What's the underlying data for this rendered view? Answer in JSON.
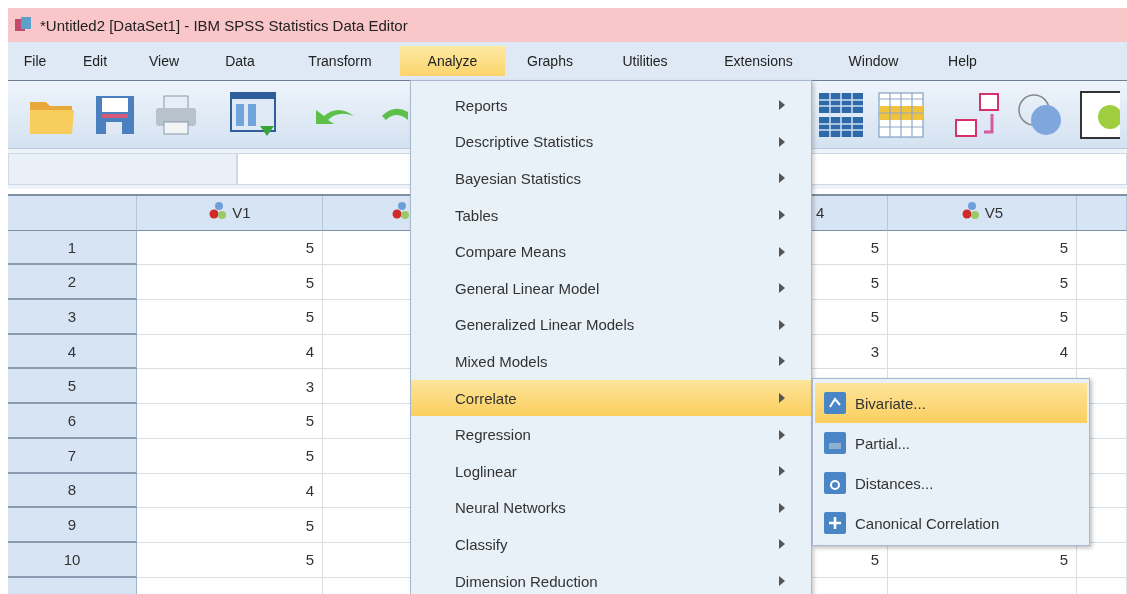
{
  "window": {
    "title": "*Untitled2 [DataSet1] - IBM SPSS Statistics Data Editor"
  },
  "menu_bar": [
    {
      "label": "File",
      "selected": false
    },
    {
      "label": "Edit",
      "selected": false
    },
    {
      "label": "View",
      "selected": false
    },
    {
      "label": "Data",
      "selected": false
    },
    {
      "label": "Transform",
      "selected": false
    },
    {
      "label": "Analyze",
      "selected": true
    },
    {
      "label": "Graphs",
      "selected": false
    },
    {
      "label": "Utilities",
      "selected": false
    },
    {
      "label": "Extensions",
      "selected": false
    },
    {
      "label": "Window",
      "selected": false
    },
    {
      "label": "Help",
      "selected": false
    }
  ],
  "analyze_menu": [
    {
      "label": "Reports",
      "selected": false
    },
    {
      "label": "Descriptive Statistics",
      "selected": false
    },
    {
      "label": "Bayesian Statistics",
      "selected": false
    },
    {
      "label": "Tables",
      "selected": false
    },
    {
      "label": "Compare Means",
      "selected": false
    },
    {
      "label": "General Linear Model",
      "selected": false
    },
    {
      "label": "Generalized Linear Models",
      "selected": false
    },
    {
      "label": "Mixed Models",
      "selected": false
    },
    {
      "label": "Correlate",
      "selected": true
    },
    {
      "label": "Regression",
      "selected": false
    },
    {
      "label": "Loglinear",
      "selected": false
    },
    {
      "label": "Neural Networks",
      "selected": false
    },
    {
      "label": "Classify",
      "selected": false
    },
    {
      "label": "Dimension Reduction",
      "selected": false
    }
  ],
  "correlate_submenu": [
    {
      "label": "Bivariate...",
      "selected": true,
      "kind": "bivariate"
    },
    {
      "label": "Partial...",
      "selected": false,
      "kind": "partial"
    },
    {
      "label": "Distances...",
      "selected": false,
      "kind": "distances"
    },
    {
      "label": "Canonical Correlation",
      "selected": false,
      "kind": "canonical"
    }
  ],
  "data_grid": {
    "columns": [
      {
        "kind": "variable",
        "header": "V1"
      },
      {
        "kind": "hidden"
      },
      {
        "kind": "hidden_plain"
      },
      {
        "kind": "cut",
        "header": "4"
      },
      {
        "kind": "variable",
        "header": "V5"
      },
      {
        "kind": "empty"
      }
    ],
    "rows": [
      {
        "number": "1",
        "v1": "5",
        "column_4": "5",
        "v5": "5"
      },
      {
        "number": "2",
        "v1": "5",
        "column_4": "5",
        "v5": "5"
      },
      {
        "number": "3",
        "v1": "5",
        "column_4": "5",
        "v5": "5"
      },
      {
        "number": "4",
        "v1": "4",
        "column_4": "3",
        "v5": "4"
      },
      {
        "number": "5",
        "v1": "3"
      },
      {
        "number": "6",
        "v1": "5"
      },
      {
        "number": "7",
        "v1": "5"
      },
      {
        "number": "8",
        "v1": "4"
      },
      {
        "number": "9",
        "v1": "5"
      },
      {
        "number": "10",
        "v1": "5",
        "column_4": "5",
        "v5": "5"
      }
    ]
  }
}
